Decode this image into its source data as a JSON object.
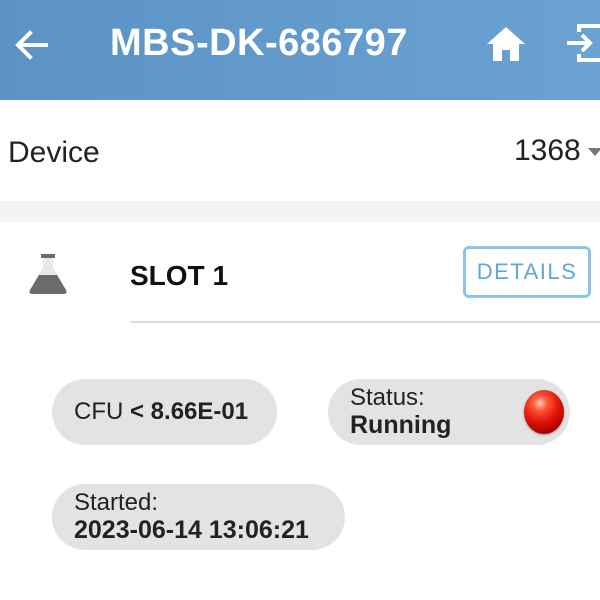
{
  "app_bar": {
    "title": "MBS-DK-686797",
    "back_icon": "arrow-left-icon",
    "home_icon": "home-icon",
    "logout_icon": "logout-icon",
    "color": "#5b93c6"
  },
  "device": {
    "label": "Device",
    "selected": "1368"
  },
  "slot": {
    "icon": "flask-icon",
    "title": "SLOT 1",
    "details_label": "DETAILS",
    "cfu": {
      "prefix": "CFU",
      "value": "< 8.66E-01"
    },
    "status": {
      "label": "Status:",
      "value": "Running",
      "indicator_color": "#e41a0c"
    },
    "started": {
      "label": "Started:",
      "value": "2023-06-14 13:06:21"
    }
  }
}
